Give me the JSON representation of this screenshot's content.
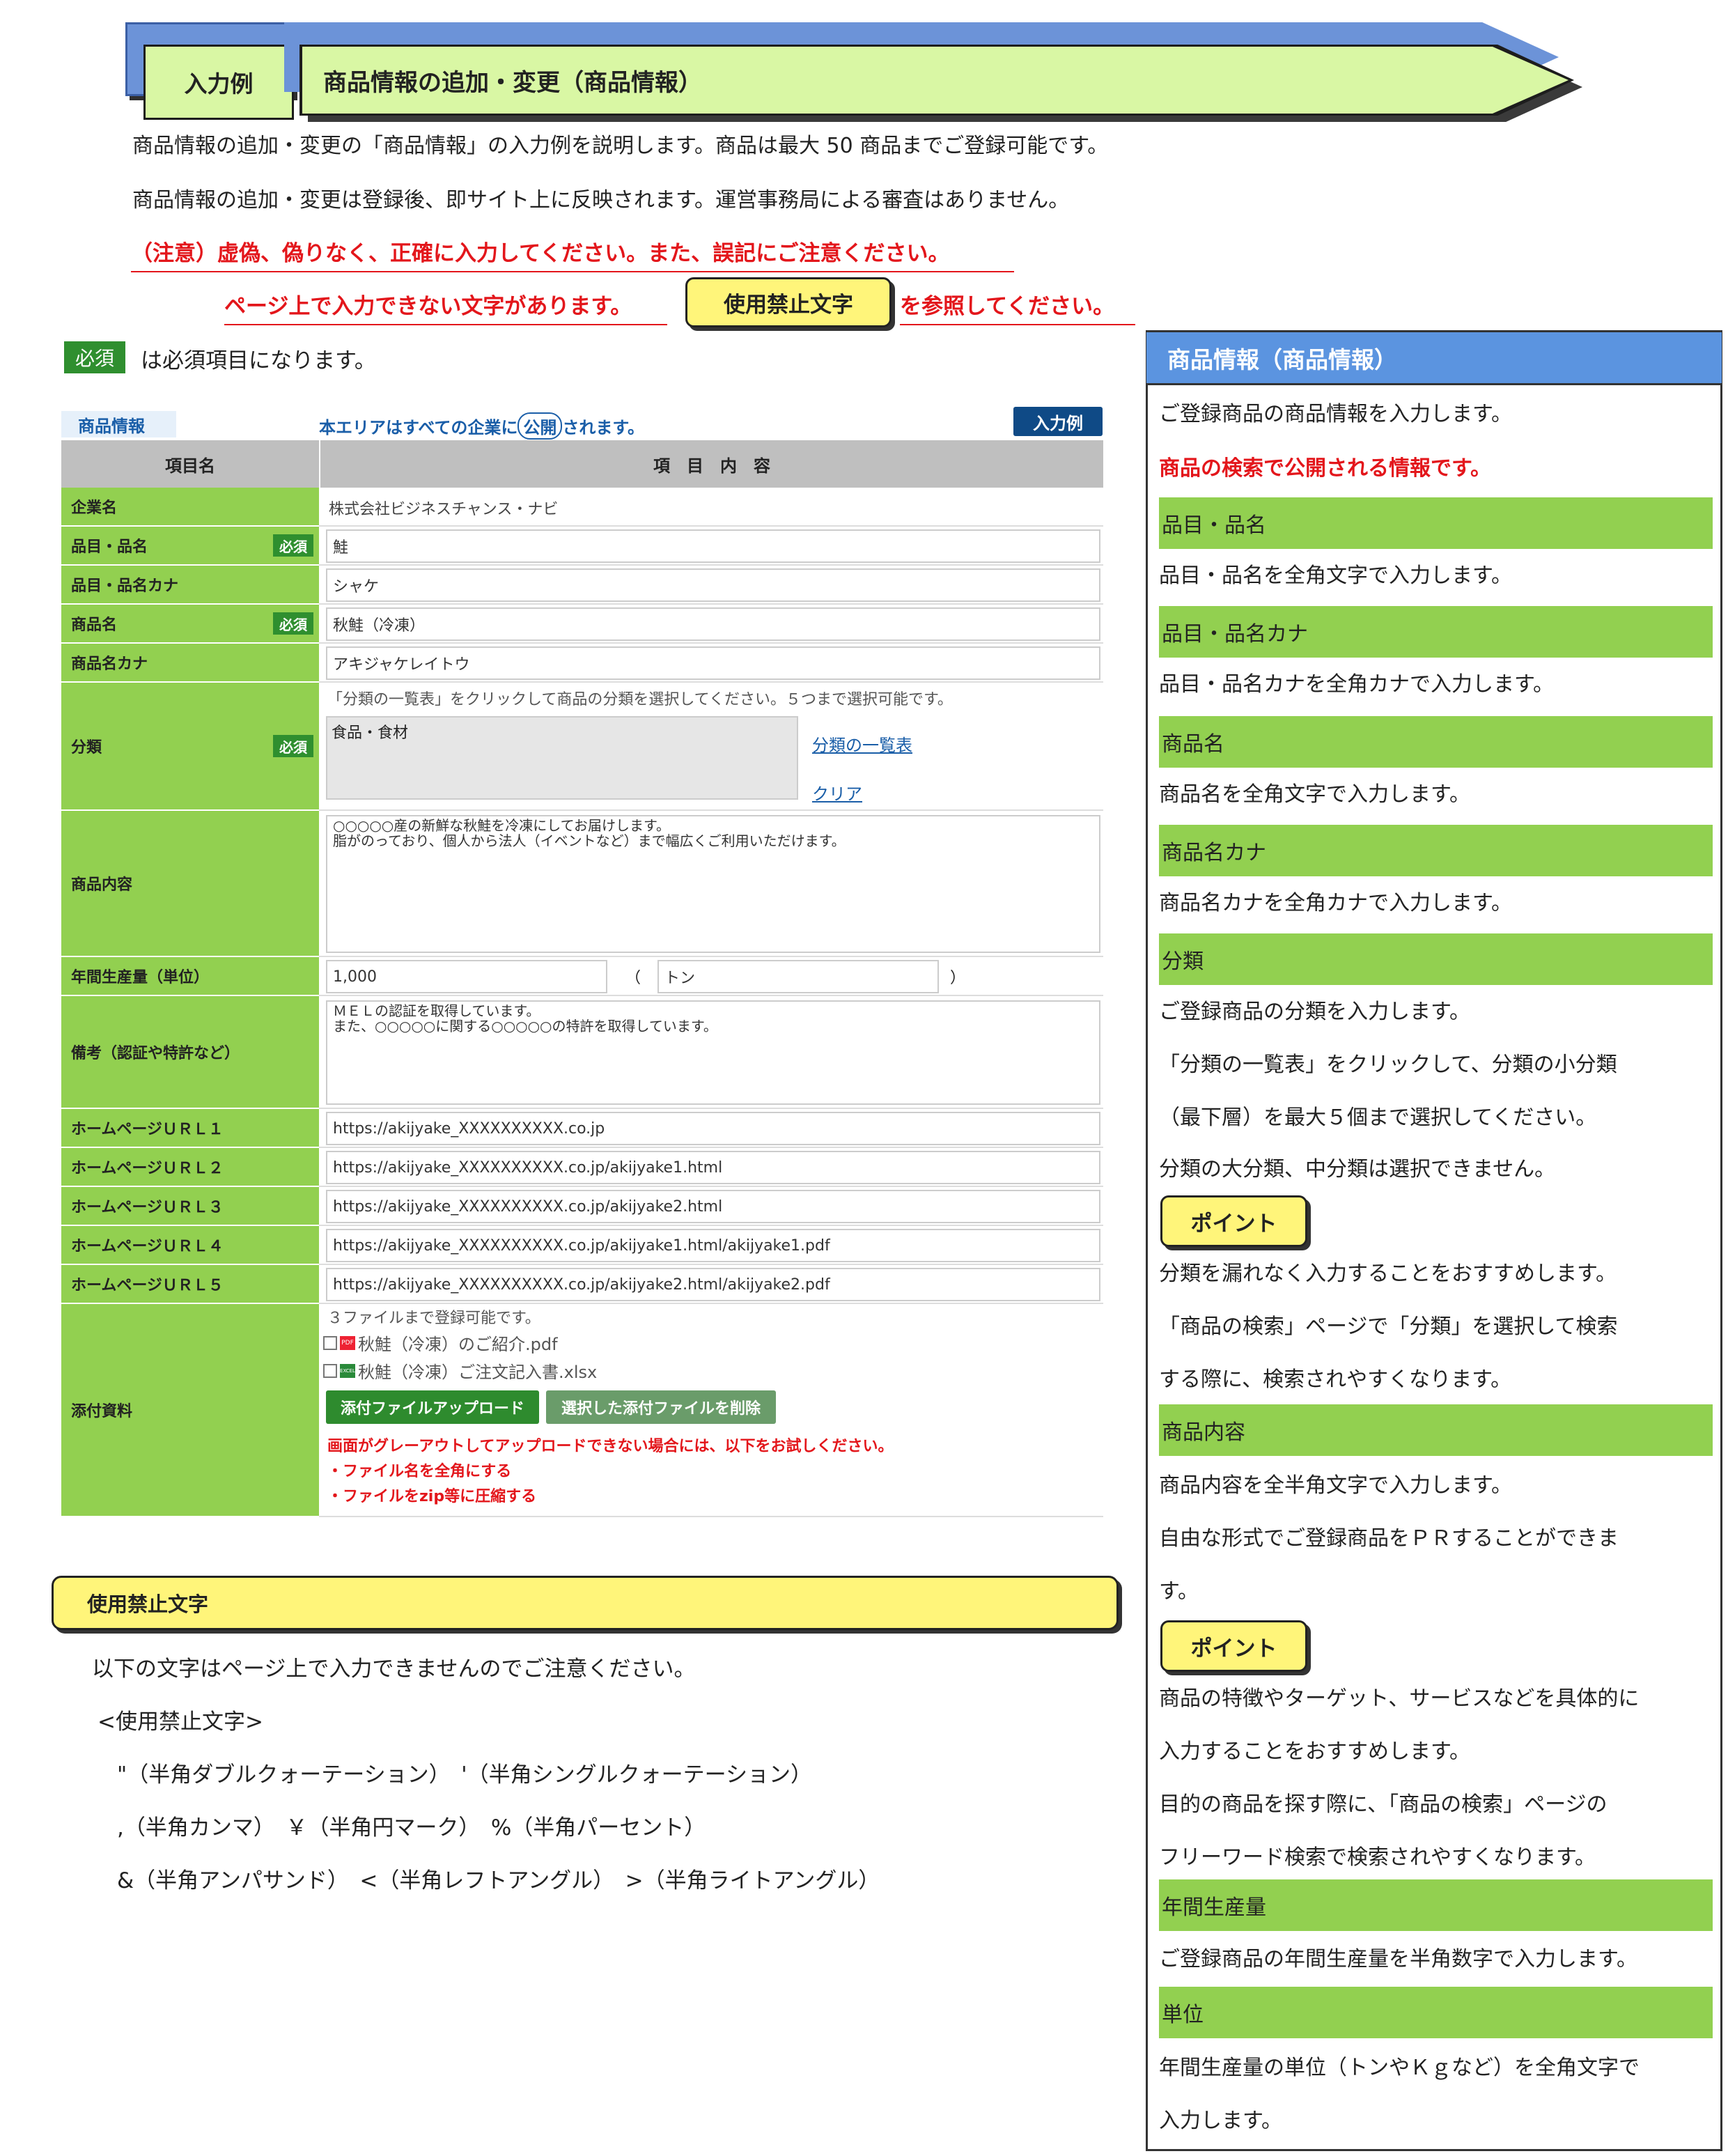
{
  "header": {
    "tab_label": "入力例",
    "banner_title": "商品情報の追加・変更（商品情報）"
  },
  "intro": {
    "line1": "商品情報の追加・変更の「商品情報」の入力例を説明します。商品は最大 50 商品までご登録可能です。",
    "line2": "商品情報の追加・変更は登録後、即サイト上に反映されます。運営事務局による審査はありません。",
    "warning1": "（注意）虚偽、偽りなく、正確に入力してください。また、誤記にご注意ください。",
    "warning2_pre": "ページ上で入力できない文字があります。",
    "forbidden_button": "使用禁止文字",
    "warning2_post": "を参照してください。",
    "required_badge": "必須",
    "required_note": "は必須項目になります。"
  },
  "form": {
    "section_tag": "商品情報",
    "public_note_pre": "本エリアはすべての企業に",
    "public_pill": "公開",
    "public_note_post": "されます。",
    "example_badge": "入力例",
    "col_item": "項目名",
    "col_content": "項　目　内　容",
    "required_badge": "必須",
    "fields": {
      "company_label": "企業名",
      "company_value": "株式会社ビジネスチャンス・ナビ",
      "item_label": "品目・品名",
      "item_value": "鮭",
      "item_kana_label": "品目・品名カナ",
      "item_kana_value": "シャケ",
      "product_label": "商品名",
      "product_value": "秋鮭（冷凍）",
      "product_kana_label": "商品名カナ",
      "product_kana_value": "アキジャケレイトウ",
      "category_label": "分類",
      "category_hint": "「分類の一覧表」をクリックして商品の分類を選択してください。５つまで選択可能です。",
      "category_value": "食品・食材",
      "category_list_link": "分類の一覧表",
      "category_clear_link": "クリア",
      "content_label": "商品内容",
      "content_line1": "○○○○○産の新鮮な秋鮭を冷凍にしてお届けします。",
      "content_line2": "脂がのっており、個人から法人（イベントなど）まで幅広くご利用いただけます。",
      "production_label": "年間生産量（単位）",
      "production_value": "1,000",
      "paren_open": "（",
      "unit_value": "トン",
      "paren_close": "）",
      "remarks_label": "備考（認証や特許など）",
      "remarks_line1": "ＭＥＬの認証を取得しています。",
      "remarks_line2": "また、○○○○○に関する○○○○○の特許を取得しています。",
      "url1_label": "ホームページＵＲＬ１",
      "url1_value": "https://akijyake_XXXXXXXXXX.co.jp",
      "url2_label": "ホームページＵＲＬ２",
      "url2_value": "https://akijyake_XXXXXXXXXX.co.jp/akijyake1.html",
      "url3_label": "ホームページＵＲＬ３",
      "url3_value": "https://akijyake_XXXXXXXXXX.co.jp/akijyake2.html",
      "url4_label": "ホームページＵＲＬ４",
      "url4_value": "https://akijyake_XXXXXXXXXX.co.jp/akijyake1.html/akijyake1.pdf",
      "url5_label": "ホームページＵＲＬ５",
      "url5_value": "https://akijyake_XXXXXXXXXX.co.jp/akijyake2.html/akijyake2.pdf",
      "attach_label": "添付資料",
      "attach_hint": "３ファイルまで登録可能です。",
      "attach_file1": "秋鮭（冷凍）のご紹介.pdf",
      "attach_file2": "秋鮭（冷凍）ご注文記入書.xlsx",
      "pdf_tag": "PDF",
      "excel_tag": "EXCEL",
      "upload_button": "添付ファイルアップロード",
      "delete_button": "選択した添付ファイルを削除",
      "attach_warn1": "画面がグレーアウトしてアップロードできない場合には、以下をお試しください。",
      "attach_warn2": "・ファイル名を全角にする",
      "attach_warn3": "・ファイルをzip等に圧縮する"
    }
  },
  "forbidden": {
    "title": "使用禁止文字",
    "line1": "以下の文字はページ上で入力できませんのでご注意ください。",
    "line2": "<使用禁止文字>",
    "line3": "\"（半角ダブルクォーテーション）　'（半角シングルクォーテーション）",
    "line4": ",（半角カンマ）　￥（半角円マーク）　%（半角パーセント）",
    "line5": "&（半角アンパサンド）　<（半角レフトアングル）　>（半角ライトアングル）"
  },
  "panel": {
    "title": "商品情報（商品情報）",
    "intro": "ご登録商品の商品情報を入力します。",
    "intro_red": "商品の検索で公開される情報です。",
    "item_h": "品目・品名",
    "item_d": "品目・品名を全角文字で入力します。",
    "item_kana_h": "品目・品名カナ",
    "item_kana_d": "品目・品名カナを全角カナで入力します。",
    "product_h": "商品名",
    "product_d": "商品名を全角文字で入力します。",
    "product_kana_h": "商品名カナ",
    "product_kana_d": "商品名カナを全角カナで入力します。",
    "category_h": "分類",
    "category_d1": "ご登録商品の分類を入力します。",
    "category_d2": "「分類の一覧表」をクリックして、分類の小分類",
    "category_d3": "（最下層）を最大５個まで選択してください。",
    "category_d4": "分類の大分類、中分類は選択できません。",
    "point_label": "ポイント",
    "category_p1": "分類を漏れなく入力することをおすすめします。",
    "category_p2": "「商品の検索」ページで「分類」を選択して検索",
    "category_p3": "する際に、検索されやすくなります。",
    "content_h": "商品内容",
    "content_d1": "商品内容を全半角文字で入力します。",
    "content_d2": "自由な形式でご登録商品をＰＲすることができま",
    "content_d3": "す。",
    "content_p1": "商品の特徴やターゲット、サービスなどを具体的に",
    "content_p2": "入力することをおすすめします。",
    "content_p3": "目的の商品を探す際に、「商品の検索」ページの",
    "content_p4": "フリーワード検索で検索されやすくなります。",
    "production_h": "年間生産量",
    "production_d": "ご登録商品の年間生産量を半角数字で入力します。",
    "unit_h": "単位",
    "unit_d1": "年間生産量の単位（トンやＫｇなど）を全角文字で",
    "unit_d2": "入力します。"
  }
}
